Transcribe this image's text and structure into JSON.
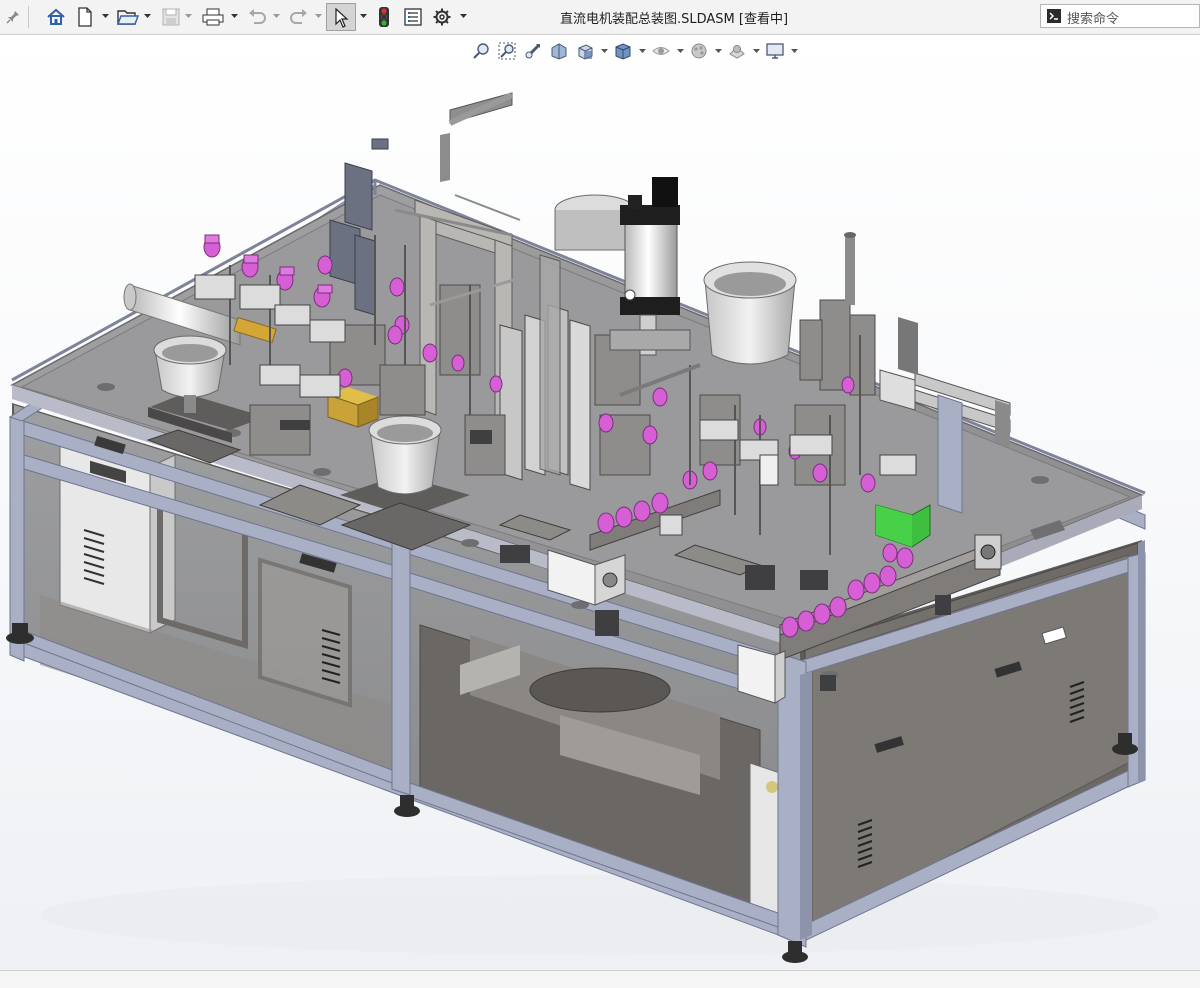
{
  "app": {
    "document_title": "直流电机装配总装图.SLDASM [查看中]"
  },
  "toolbar": {
    "items": [
      {
        "name": "pin-icon"
      },
      {
        "name": "home-icon"
      },
      {
        "name": "new-document-icon"
      },
      {
        "name": "open-folder-icon"
      },
      {
        "name": "save-icon"
      },
      {
        "name": "print-icon"
      },
      {
        "name": "undo-icon"
      },
      {
        "name": "redo-icon"
      },
      {
        "name": "select-cursor-icon"
      },
      {
        "name": "traffic-light-icon"
      },
      {
        "name": "file-properties-icon"
      },
      {
        "name": "options-gear-icon"
      }
    ]
  },
  "search": {
    "placeholder": "搜索命令"
  },
  "heads_up_toolbar": {
    "items": [
      "zoom-to-fit-icon",
      "zoom-to-area-icon",
      "previous-view-icon",
      "section-view-icon",
      "view-orientation-icon",
      "display-style-icon",
      "hide-show-items-icon",
      "edit-appearance-icon",
      "apply-scene-icon",
      "view-settings-icon"
    ]
  },
  "colors": {
    "frame": "#a9afc4",
    "frame_dark": "#7d839b",
    "panel": "#6e6a66",
    "glass": "#d8dde6",
    "magenta": "#d65fd6",
    "green": "#3fbf3f",
    "gold": "#c9a23a"
  }
}
